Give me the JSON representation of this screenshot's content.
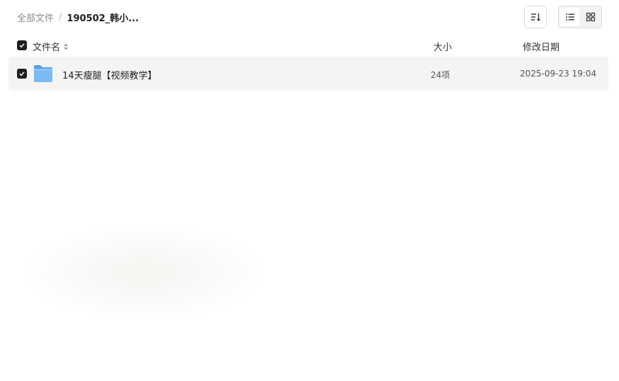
{
  "breadcrumb": {
    "root": "全部文件",
    "separator": "/",
    "current": "190502_韩小..."
  },
  "toolbar": {
    "sort_icon": "sort-icon",
    "list_view_icon": "list-view-icon",
    "grid_view_icon": "grid-view-icon",
    "active_view": "list"
  },
  "table": {
    "headers": {
      "name": "文件名",
      "size": "大小",
      "date": "修改日期"
    },
    "select_all_checked": true,
    "rows": [
      {
        "icon": "folder-icon",
        "name": "14天瘦腿【视频教学】",
        "size": "24项",
        "date": "2025-09-23 19:04",
        "checked": true
      }
    ]
  },
  "colors": {
    "folder": "#6aaef0",
    "checkbox": "#1f1f1f",
    "row_selected_bg": "#f4f4f4"
  }
}
